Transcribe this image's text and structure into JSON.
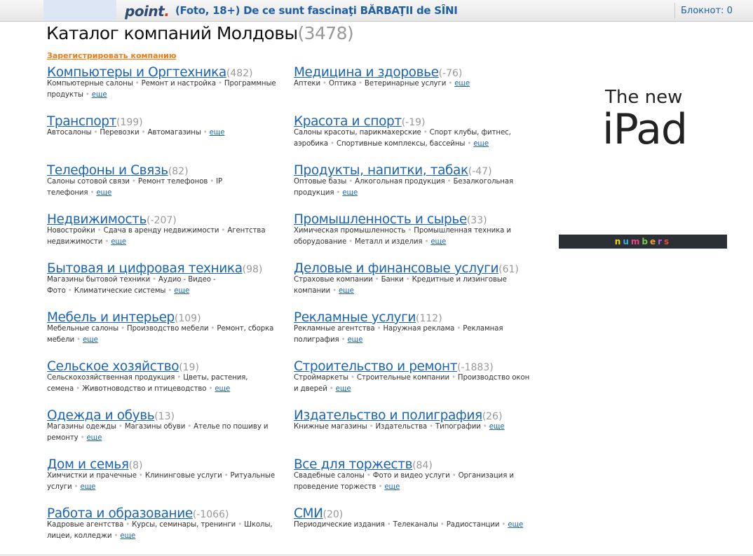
{
  "topbar": {
    "logo": "point",
    "headline": "(Foto, 18+) De ce sunt fascinaţi BĂRBAŢII de SÎNI",
    "notepad": "Блокнот: 0"
  },
  "title": {
    "text": "Каталог компаний Молдовы",
    "count": "(3478)"
  },
  "register_link": "Зарегистрировать компанию",
  "more_label": "еще",
  "left_column": [
    {
      "name": "Компьютеры и Оргтехника",
      "count": "(482)",
      "subs": [
        "Компьютерные салоны",
        "Ремонт и настройка",
        "Программные продукты"
      ]
    },
    {
      "name": "Транспорт",
      "count": "(199)",
      "subs": [
        "Автосалоны",
        "Перевозки",
        "Автомагазины"
      ]
    },
    {
      "name": "Телефоны и Связь",
      "count": "(82)",
      "subs": [
        "Салоны сотовой связи",
        "Ремонт телефонов",
        "IP телефония"
      ]
    },
    {
      "name": "Недвижимость",
      "count": "(-207)",
      "subs": [
        "Новостройки",
        "Сдача в аренду недвижимости",
        "Агентства недвижимости"
      ]
    },
    {
      "name": "Бытовая и цифровая техника",
      "count": "(98)",
      "subs": [
        "Магазины бытовой техники",
        "Аудио - Видео - Фото",
        "Климатические системы"
      ]
    },
    {
      "name": "Мебель и интерьер",
      "count": "(109)",
      "subs": [
        "Мебельные салоны",
        "Производство мебели",
        "Ремонт, сборка мебели"
      ]
    },
    {
      "name": "Сельское хозяйство",
      "count": "(19)",
      "subs": [
        "Сельскохозяйственная продукция",
        "Цветы, растения, семена",
        "Животноводство и птицеводство"
      ]
    },
    {
      "name": "Одежда и обувь",
      "count": "(13)",
      "subs": [
        "Магазины одежды",
        "Магазины обуви",
        "Ателье по пошиву и ремонту"
      ]
    },
    {
      "name": "Дом и семья",
      "count": "(8)",
      "subs": [
        "Химчистки и прачечные",
        "Клининговые услуги",
        "Ритуальные услуги"
      ]
    },
    {
      "name": "Работа и образование",
      "count": "(-1066)",
      "subs": [
        "Кадровые агентства",
        "Курсы, семинары, тренинги",
        "Школы, лицеи, колледжи"
      ]
    }
  ],
  "right_column": [
    {
      "name": "Медицина и здоровье",
      "count": "(-76)",
      "subs": [
        "Аптеки",
        "Оптика",
        "Ветеринарные услуги"
      ]
    },
    {
      "name": "Красота и спорт",
      "count": "(-19)",
      "subs": [
        "Салоны красоты, парикмахерские",
        "Спорт клубы, фитнес, аэробика",
        "Спортивные комплексы, бассейны"
      ]
    },
    {
      "name": "Продукты, напитки, табак",
      "count": "(-47)",
      "subs": [
        "Оптовые базы",
        "Алкогольная продукция",
        "Безалкогольная продукция"
      ]
    },
    {
      "name": "Промышленность и сырье",
      "count": "(33)",
      "subs": [
        "Химическая промышленность",
        "Промышленная техника и оборудование",
        "Металл и изделия"
      ]
    },
    {
      "name": "Деловые и финансовые услуги",
      "count": "(61)",
      "subs": [
        "Страховые компании",
        "Банки",
        "Кредитные и лизинговые компании"
      ]
    },
    {
      "name": "Рекламные услуги",
      "count": "(112)",
      "subs": [
        "Рекламные агентства",
        "Наружная реклама",
        "Рекламная полиграфия"
      ]
    },
    {
      "name": "Строительство и ремонт",
      "count": "(-1883)",
      "subs": [
        "Строймаркеты",
        "Строительные компании",
        "Производство окон и дверей"
      ]
    },
    {
      "name": "Издательство и полиграфия",
      "count": "(26)",
      "subs": [
        "Книжные магазины",
        "Издательства",
        "Типографии"
      ]
    },
    {
      "name": "Все для торжеств",
      "count": "(84)",
      "subs": [
        "Свадебные салоны",
        "Фото и видео услуги",
        "Организация и проведение торжеств"
      ]
    },
    {
      "name": "СМИ",
      "count": "(20)",
      "subs": [
        "Периодические издания",
        "Телеканалы",
        "Радиостанции"
      ]
    }
  ],
  "ad": {
    "line1": "The new",
    "line2": "iPad",
    "brand": "numbers",
    "brand_colors": [
      "#f5d90a",
      "#3ab0e6",
      "#e8468c",
      "#7ac943",
      "#f0a020",
      "#c05cd6",
      "#e84a3a"
    ]
  }
}
